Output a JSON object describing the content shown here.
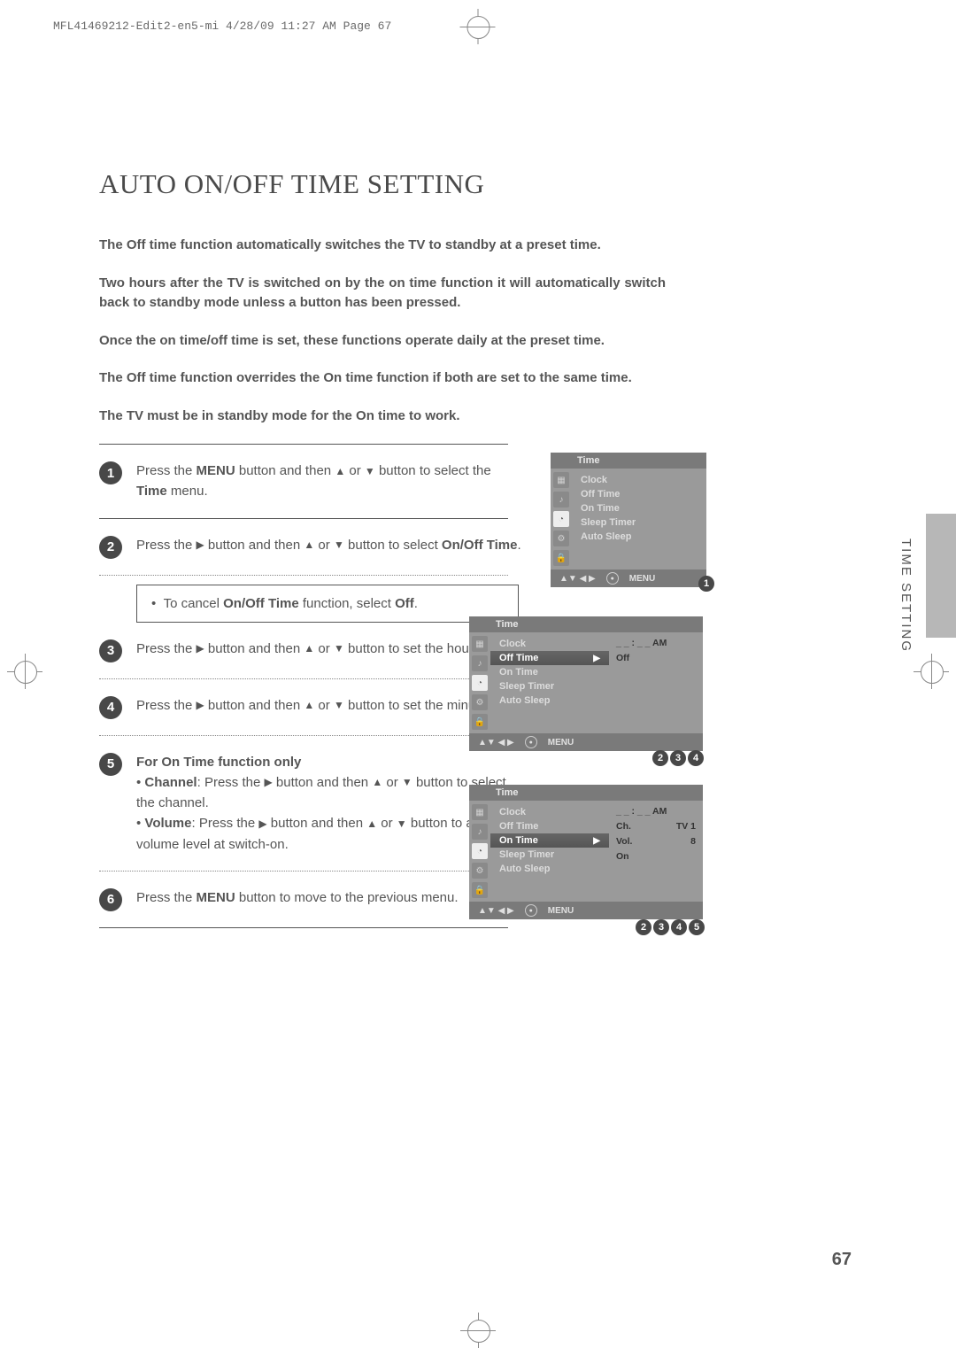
{
  "print_header": "MFL41469212-Edit2-en5-mi  4/28/09  11:27 AM  Page 67",
  "title": "AUTO ON/OFF TIME SETTING",
  "intro": {
    "p1": "The Off time function automatically switches the TV to standby at a preset time.",
    "p2": "Two hours after the TV is switched on by the on time function it will automatically switch back to standby mode unless a button has been pressed.",
    "p3": "Once the on time/off time is set, these functions operate daily at the preset time.",
    "p4": "The Off time function overrides the On time function if both are set to the same time.",
    "p5": "The TV must be in standby mode for the On time to work."
  },
  "steps": {
    "s1a": "Press the ",
    "s1b": "MENU",
    "s1c": " button and then ",
    "s1d": " or ",
    "s1e": " button to select the ",
    "s1f": "Time",
    "s1g": " menu.",
    "s2a": "Press the ",
    "s2b": " button and then ",
    "s2c": " or ",
    "s2d": " button to select ",
    "s2e": "On/Off Time",
    "s2f": ".",
    "notea": "To cancel ",
    "noteb": "On/Off Time",
    "notec": " function, select ",
    "noted": "Off",
    "notee": ".",
    "s3a": "Press the ",
    "s3b": " button and then ",
    "s3c": " or ",
    "s3d": " button to set the hour.",
    "s4a": "Press the ",
    "s4b": " button and then ",
    "s4c": " or ",
    "s4d": " button to set the minutes.",
    "s5title": "For On Time function only",
    "s5_ch_a": "Channel",
    "s5_ch_b": ": Press the ",
    "s5_ch_c": " button and then ",
    "s5_ch_d": " or ",
    "s5_ch_e": " button to select the channel.",
    "s5_vol_a": "Volume",
    "s5_vol_b": ": Press the ",
    "s5_vol_c": " button and then ",
    "s5_vol_d": " or ",
    "s5_vol_e": " button to adjust volume level at switch-on.",
    "s6a": "Press the ",
    "s6b": "MENU",
    "s6c": " button to move to the previous menu."
  },
  "arrows": {
    "up": "▲",
    "down": "▼",
    "left": "◀",
    "right": "▶"
  },
  "side_label": "TIME SETTING",
  "page_number": "67",
  "osd_common": {
    "title": "Time",
    "menu_items": [
      "Clock",
      "Off Time",
      "On Time",
      "Sleep Timer",
      "Auto Sleep"
    ],
    "nav_arrows": "▲▼  ◀ ▶",
    "nav_menu": "MENU"
  },
  "osd2_detail": {
    "time": "_ _ : _ _ AM",
    "status": "Off"
  },
  "osd3_detail": {
    "time": "_ _ : _ _ AM",
    "ch_label": "Ch.",
    "ch_value": "TV   1",
    "vol_label": "Vol.",
    "vol_value": "8",
    "status": "On"
  },
  "refs": {
    "r1": [
      "1"
    ],
    "r2": [
      "2",
      "3",
      "4"
    ],
    "r3": [
      "2",
      "3",
      "4",
      "5"
    ]
  }
}
